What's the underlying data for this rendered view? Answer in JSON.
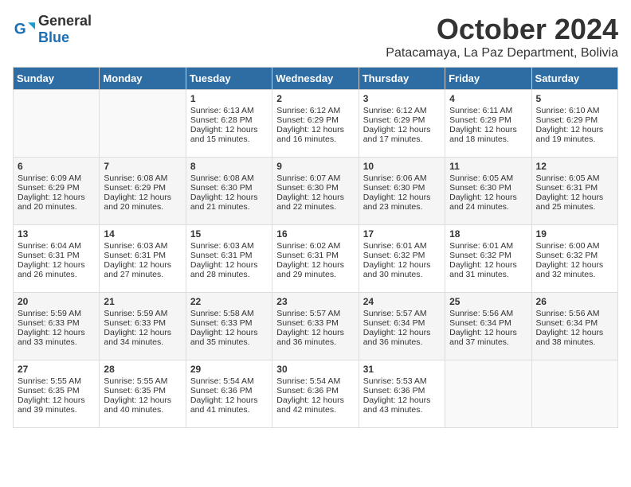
{
  "header": {
    "logo_general": "General",
    "logo_blue": "Blue",
    "month_title": "October 2024",
    "location": "Patacamaya, La Paz Department, Bolivia"
  },
  "days_of_week": [
    "Sunday",
    "Monday",
    "Tuesday",
    "Wednesday",
    "Thursday",
    "Friday",
    "Saturday"
  ],
  "weeks": [
    [
      {
        "day": "",
        "sunrise": "",
        "sunset": "",
        "daylight": ""
      },
      {
        "day": "",
        "sunrise": "",
        "sunset": "",
        "daylight": ""
      },
      {
        "day": "1",
        "sunrise": "Sunrise: 6:13 AM",
        "sunset": "Sunset: 6:28 PM",
        "daylight": "Daylight: 12 hours and 15 minutes."
      },
      {
        "day": "2",
        "sunrise": "Sunrise: 6:12 AM",
        "sunset": "Sunset: 6:29 PM",
        "daylight": "Daylight: 12 hours and 16 minutes."
      },
      {
        "day": "3",
        "sunrise": "Sunrise: 6:12 AM",
        "sunset": "Sunset: 6:29 PM",
        "daylight": "Daylight: 12 hours and 17 minutes."
      },
      {
        "day": "4",
        "sunrise": "Sunrise: 6:11 AM",
        "sunset": "Sunset: 6:29 PM",
        "daylight": "Daylight: 12 hours and 18 minutes."
      },
      {
        "day": "5",
        "sunrise": "Sunrise: 6:10 AM",
        "sunset": "Sunset: 6:29 PM",
        "daylight": "Daylight: 12 hours and 19 minutes."
      }
    ],
    [
      {
        "day": "6",
        "sunrise": "Sunrise: 6:09 AM",
        "sunset": "Sunset: 6:29 PM",
        "daylight": "Daylight: 12 hours and 20 minutes."
      },
      {
        "day": "7",
        "sunrise": "Sunrise: 6:08 AM",
        "sunset": "Sunset: 6:29 PM",
        "daylight": "Daylight: 12 hours and 20 minutes."
      },
      {
        "day": "8",
        "sunrise": "Sunrise: 6:08 AM",
        "sunset": "Sunset: 6:30 PM",
        "daylight": "Daylight: 12 hours and 21 minutes."
      },
      {
        "day": "9",
        "sunrise": "Sunrise: 6:07 AM",
        "sunset": "Sunset: 6:30 PM",
        "daylight": "Daylight: 12 hours and 22 minutes."
      },
      {
        "day": "10",
        "sunrise": "Sunrise: 6:06 AM",
        "sunset": "Sunset: 6:30 PM",
        "daylight": "Daylight: 12 hours and 23 minutes."
      },
      {
        "day": "11",
        "sunrise": "Sunrise: 6:05 AM",
        "sunset": "Sunset: 6:30 PM",
        "daylight": "Daylight: 12 hours and 24 minutes."
      },
      {
        "day": "12",
        "sunrise": "Sunrise: 6:05 AM",
        "sunset": "Sunset: 6:31 PM",
        "daylight": "Daylight: 12 hours and 25 minutes."
      }
    ],
    [
      {
        "day": "13",
        "sunrise": "Sunrise: 6:04 AM",
        "sunset": "Sunset: 6:31 PM",
        "daylight": "Daylight: 12 hours and 26 minutes."
      },
      {
        "day": "14",
        "sunrise": "Sunrise: 6:03 AM",
        "sunset": "Sunset: 6:31 PM",
        "daylight": "Daylight: 12 hours and 27 minutes."
      },
      {
        "day": "15",
        "sunrise": "Sunrise: 6:03 AM",
        "sunset": "Sunset: 6:31 PM",
        "daylight": "Daylight: 12 hours and 28 minutes."
      },
      {
        "day": "16",
        "sunrise": "Sunrise: 6:02 AM",
        "sunset": "Sunset: 6:31 PM",
        "daylight": "Daylight: 12 hours and 29 minutes."
      },
      {
        "day": "17",
        "sunrise": "Sunrise: 6:01 AM",
        "sunset": "Sunset: 6:32 PM",
        "daylight": "Daylight: 12 hours and 30 minutes."
      },
      {
        "day": "18",
        "sunrise": "Sunrise: 6:01 AM",
        "sunset": "Sunset: 6:32 PM",
        "daylight": "Daylight: 12 hours and 31 minutes."
      },
      {
        "day": "19",
        "sunrise": "Sunrise: 6:00 AM",
        "sunset": "Sunset: 6:32 PM",
        "daylight": "Daylight: 12 hours and 32 minutes."
      }
    ],
    [
      {
        "day": "20",
        "sunrise": "Sunrise: 5:59 AM",
        "sunset": "Sunset: 6:33 PM",
        "daylight": "Daylight: 12 hours and 33 minutes."
      },
      {
        "day": "21",
        "sunrise": "Sunrise: 5:59 AM",
        "sunset": "Sunset: 6:33 PM",
        "daylight": "Daylight: 12 hours and 34 minutes."
      },
      {
        "day": "22",
        "sunrise": "Sunrise: 5:58 AM",
        "sunset": "Sunset: 6:33 PM",
        "daylight": "Daylight: 12 hours and 35 minutes."
      },
      {
        "day": "23",
        "sunrise": "Sunrise: 5:57 AM",
        "sunset": "Sunset: 6:33 PM",
        "daylight": "Daylight: 12 hours and 36 minutes."
      },
      {
        "day": "24",
        "sunrise": "Sunrise: 5:57 AM",
        "sunset": "Sunset: 6:34 PM",
        "daylight": "Daylight: 12 hours and 36 minutes."
      },
      {
        "day": "25",
        "sunrise": "Sunrise: 5:56 AM",
        "sunset": "Sunset: 6:34 PM",
        "daylight": "Daylight: 12 hours and 37 minutes."
      },
      {
        "day": "26",
        "sunrise": "Sunrise: 5:56 AM",
        "sunset": "Sunset: 6:34 PM",
        "daylight": "Daylight: 12 hours and 38 minutes."
      }
    ],
    [
      {
        "day": "27",
        "sunrise": "Sunrise: 5:55 AM",
        "sunset": "Sunset: 6:35 PM",
        "daylight": "Daylight: 12 hours and 39 minutes."
      },
      {
        "day": "28",
        "sunrise": "Sunrise: 5:55 AM",
        "sunset": "Sunset: 6:35 PM",
        "daylight": "Daylight: 12 hours and 40 minutes."
      },
      {
        "day": "29",
        "sunrise": "Sunrise: 5:54 AM",
        "sunset": "Sunset: 6:36 PM",
        "daylight": "Daylight: 12 hours and 41 minutes."
      },
      {
        "day": "30",
        "sunrise": "Sunrise: 5:54 AM",
        "sunset": "Sunset: 6:36 PM",
        "daylight": "Daylight: 12 hours and 42 minutes."
      },
      {
        "day": "31",
        "sunrise": "Sunrise: 5:53 AM",
        "sunset": "Sunset: 6:36 PM",
        "daylight": "Daylight: 12 hours and 43 minutes."
      },
      {
        "day": "",
        "sunrise": "",
        "sunset": "",
        "daylight": ""
      },
      {
        "day": "",
        "sunrise": "",
        "sunset": "",
        "daylight": ""
      }
    ]
  ]
}
